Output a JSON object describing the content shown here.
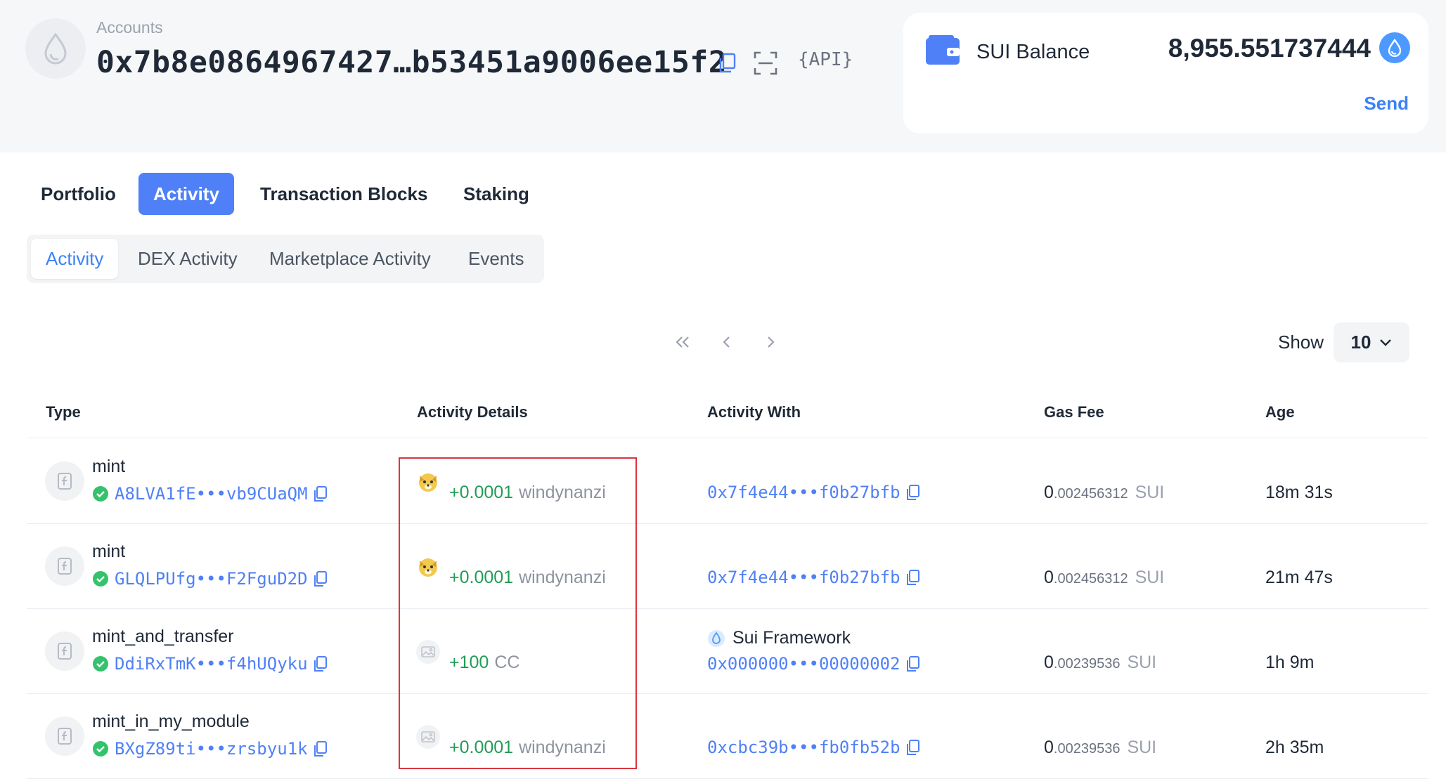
{
  "account": {
    "label": "Accounts",
    "address": "0x7b8e0864967427…b53451a9006ee15f2",
    "api_label": "{API}"
  },
  "balance": {
    "label": "SUI Balance",
    "value": "8,955.551737444",
    "send_label": "Send"
  },
  "tabs": [
    {
      "label": "Portfolio",
      "active": false
    },
    {
      "label": "Activity",
      "active": true
    },
    {
      "label": "Transaction Blocks",
      "active": false
    },
    {
      "label": "Staking",
      "active": false
    }
  ],
  "subtabs": [
    {
      "label": "Activity",
      "active": true
    },
    {
      "label": "DEX Activity",
      "active": false
    },
    {
      "label": "Marketplace Activity",
      "active": false
    },
    {
      "label": "Events",
      "active": false
    }
  ],
  "pagination": {
    "show_label": "Show",
    "page_size": "10"
  },
  "table": {
    "headers": [
      "Type",
      "Activity Details",
      "Activity With",
      "Gas Fee",
      "Age"
    ],
    "rows": [
      {
        "type": "mint",
        "digest": "A8LVA1fE•••vb9CUaQM",
        "amount": "+0.0001",
        "symbol": "windynanzi",
        "coin_icon": "dog-coin-icon",
        "with_name": "",
        "with_addr": "0x7f4e44•••f0b27bfb",
        "gas_int": "0",
        "gas_frac": ".002456312",
        "gas_unit": "SUI",
        "age": "18m 31s"
      },
      {
        "type": "mint",
        "digest": "GLQLPUfg•••F2FguD2D",
        "amount": "+0.0001",
        "symbol": "windynanzi",
        "coin_icon": "dog-coin-icon",
        "with_name": "",
        "with_addr": "0x7f4e44•••f0b27bfb",
        "gas_int": "0",
        "gas_frac": ".002456312",
        "gas_unit": "SUI",
        "age": "21m 47s"
      },
      {
        "type": "mint_and_transfer",
        "digest": "DdiRxTmK•••f4hUQyku",
        "amount": "+100",
        "symbol": "CC",
        "coin_icon": "image-placeholder-icon",
        "with_name": "Sui Framework",
        "with_addr": "0x000000•••00000002",
        "gas_int": "0",
        "gas_frac": ".00239536",
        "gas_unit": "SUI",
        "age": "1h 9m"
      },
      {
        "type": "mint_in_my_module",
        "digest": "BXgZ89ti•••zrsbyu1k",
        "amount": "+0.0001",
        "symbol": "windynanzi",
        "coin_icon": "image-placeholder-icon",
        "with_name": "",
        "with_addr": "0xcbc39b•••fb0fb52b",
        "gas_int": "0",
        "gas_frac": ".00239536",
        "gas_unit": "SUI",
        "age": "2h 35m"
      }
    ]
  },
  "colors": {
    "accent": "#4f80f7",
    "positive": "#1f9d55",
    "highlight": "#d9363e"
  }
}
